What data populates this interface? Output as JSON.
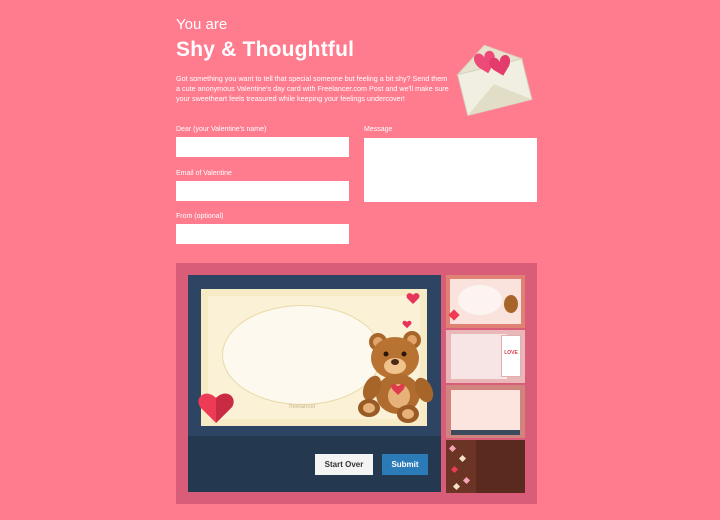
{
  "header": {
    "subtitle": "You are",
    "title": "Shy & Thoughtful",
    "intro": "Got something you want to tell that special someone but feeling a bit shy? Send them a cute anonymous Valentine's day card with Freelancer.com Post and we'll make sure your sweetheart feels treasured while keeping your feelings undercover!"
  },
  "form": {
    "dear_label": "Dear (your Valentine's name)",
    "dear_value": "",
    "email_label": "Email of Valentine",
    "email_value": "",
    "from_label": "From (optional)",
    "from_value": "",
    "message_label": "Message",
    "message_value": ""
  },
  "card": {
    "watermark": "freelancer",
    "thumb2_tag": "LOVE"
  },
  "actions": {
    "start_over": "Start Over",
    "submit": "Submit"
  },
  "colors": {
    "background": "#ff7c8f",
    "editor_panel": "#d95c79",
    "stage": "#2d4462",
    "submit": "#2a7bb8"
  }
}
